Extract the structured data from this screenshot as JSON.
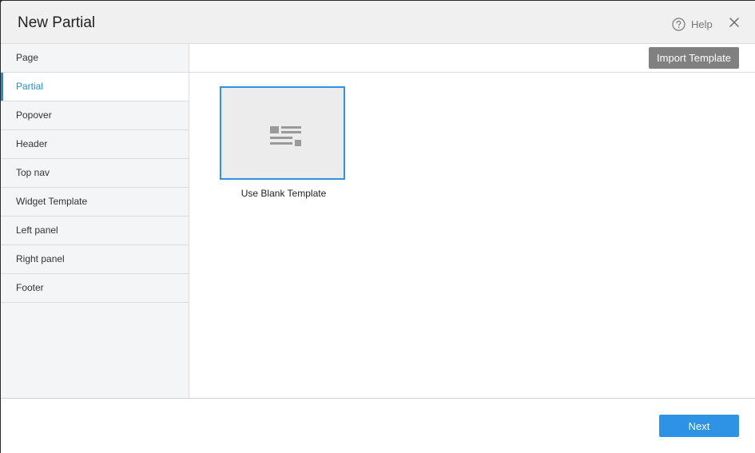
{
  "dialog": {
    "title": "New Partial",
    "help_label": "Help",
    "help_icon": "question-circle-icon",
    "close_icon": "close-icon"
  },
  "sidebar": {
    "items": [
      {
        "label": "Page",
        "active": false
      },
      {
        "label": "Partial",
        "active": true
      },
      {
        "label": "Popover",
        "active": false
      },
      {
        "label": "Header",
        "active": false
      },
      {
        "label": "Top nav",
        "active": false
      },
      {
        "label": "Widget Template",
        "active": false
      },
      {
        "label": "Left panel",
        "active": false
      },
      {
        "label": "Right panel",
        "active": false
      },
      {
        "label": "Footer",
        "active": false
      }
    ]
  },
  "toolbar": {
    "import_label": "Import Template"
  },
  "templates": [
    {
      "label": "Use Blank Template",
      "icon": "blank-template-icon",
      "selected": true
    }
  ],
  "footer": {
    "next_label": "Next"
  },
  "colors": {
    "accent": "#2e93e5",
    "active_text": "#1a8fe0",
    "import_button": "#808080",
    "header_bg": "#f0f0f0",
    "sidebar_bg": "#f4f5f7"
  }
}
